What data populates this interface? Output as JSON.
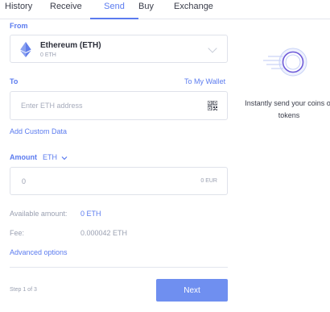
{
  "tabs": [
    {
      "label": "History"
    },
    {
      "label": "Receive"
    },
    {
      "label": "Send"
    },
    {
      "label": "Buy"
    },
    {
      "label": "Exchange"
    }
  ],
  "active_tab": "Send",
  "from": {
    "label": "From",
    "asset_name": "Ethereum (ETH)",
    "asset_balance": "0 ETH",
    "icon": "ethereum-icon"
  },
  "to": {
    "label": "To",
    "wallet_link": "To My Wallet",
    "address_placeholder": "Enter ETH address",
    "address_value": "",
    "qr_icon": "qr-code-icon"
  },
  "custom_data_link": "Add Custom Data",
  "amount": {
    "label": "Amount",
    "currency": "ETH",
    "placeholder": "0",
    "value": "",
    "fiat_value": "0 EUR"
  },
  "available": {
    "label": "Available amount:",
    "value": "0 ETH"
  },
  "fee": {
    "label": "Fee:",
    "value": "0.000042 ETH"
  },
  "advanced_options_link": "Advanced options",
  "step": "Step 1 of 3",
  "next_button": "Next",
  "promo": {
    "text": "Instantly send your coins or tokens",
    "icon": "send-coin-icon"
  },
  "colors": {
    "accent": "#5b7bef",
    "button": "#6f8ff0",
    "muted": "#9aa0b1",
    "border": "#dfe2ea"
  }
}
